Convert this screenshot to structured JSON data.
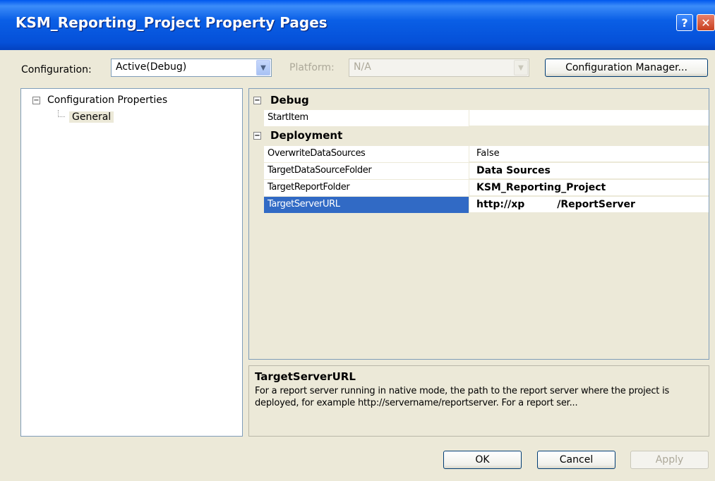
{
  "window": {
    "title": "KSM_Reporting_Project Property Pages",
    "help_glyph": "?",
    "close_glyph": "✕"
  },
  "toolbar": {
    "configuration_label": "Configuration:",
    "configuration_value": "Active(Debug)",
    "platform_label": "Platform:",
    "platform_value": "N/A",
    "config_manager_label": "Configuration Manager..."
  },
  "tree": {
    "root_label": "Configuration Properties",
    "child_label": "General"
  },
  "grid": {
    "categories": [
      {
        "label": "Debug",
        "properties": [
          {
            "name": "StartItem",
            "value": ""
          }
        ]
      },
      {
        "label": "Deployment",
        "properties": [
          {
            "name": "OverwriteDataSources",
            "value": "False"
          },
          {
            "name": "TargetDataSourceFolder",
            "value": "Data Sources"
          },
          {
            "name": "TargetReportFolder",
            "value": "KSM_Reporting_Project"
          },
          {
            "name": "TargetServerURL",
            "value_prefix": "http://xp",
            "value_suffix": "/ReportServer"
          }
        ]
      }
    ],
    "selected_property": "TargetServerURL"
  },
  "description": {
    "title": "TargetServerURL",
    "text": "For a report server running in native mode, the path to the report server where the project is deployed, for example http://servername/reportserver.  For a report ser..."
  },
  "buttons": {
    "ok": "OK",
    "cancel": "Cancel",
    "apply": "Apply"
  },
  "colors": {
    "titlebar": "#0550D8",
    "selection": "#316AC5",
    "dialog_bg": "#ECE9D8"
  }
}
